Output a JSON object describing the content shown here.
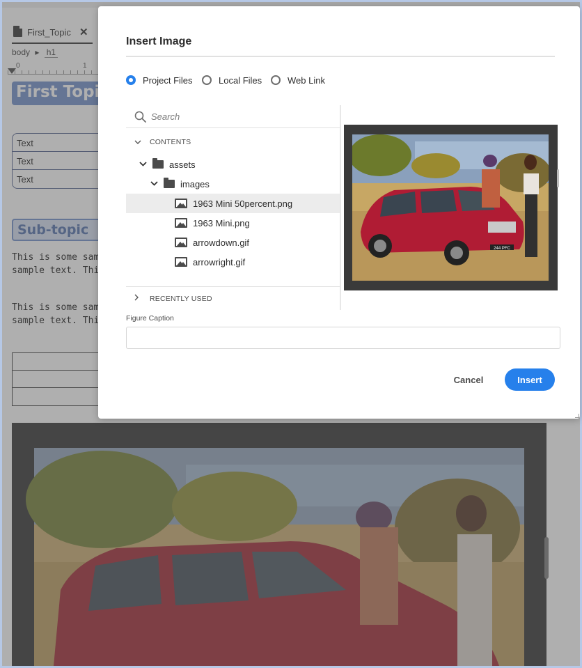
{
  "editor": {
    "tab_label": "First_Topic",
    "tab_close": "✕",
    "breadcrumb": [
      "body",
      "h1"
    ],
    "breadcrumb_sep": "▸",
    "ruler_labels": [
      "0",
      "1"
    ],
    "heading_main": "First Topi",
    "table_cells": [
      "Text",
      "Text",
      "Text"
    ],
    "heading_sub": "Sub-topic",
    "para1": [
      "This is some samp",
      "sample text. This i"
    ],
    "para2": [
      "This is some samp",
      "sample text. This i"
    ]
  },
  "dialog": {
    "title": "Insert Image",
    "source_options": [
      {
        "label": "Project Files",
        "selected": true
      },
      {
        "label": "Local Files",
        "selected": false
      },
      {
        "label": "Web Link",
        "selected": false
      }
    ],
    "search": {
      "placeholder": "Search",
      "icon": "search-icon"
    },
    "sections": {
      "contents": "CONTENTS",
      "recent": "RECENTLY USED"
    },
    "tree": {
      "assets": "assets",
      "images": "images",
      "files": [
        "1963 Mini 50percent.png",
        "1963 Mini.png",
        "arrowdown.gif",
        "arrowright.gif"
      ],
      "selected_file": "1963 Mini 50percent.png"
    },
    "caption": {
      "label": "Figure Caption",
      "value": ""
    },
    "buttons": {
      "cancel": "Cancel",
      "insert": "Insert"
    },
    "colors": {
      "accent": "#2680eb",
      "selected_row": "#ececec"
    },
    "preview_plate_text": "244 PFC"
  }
}
